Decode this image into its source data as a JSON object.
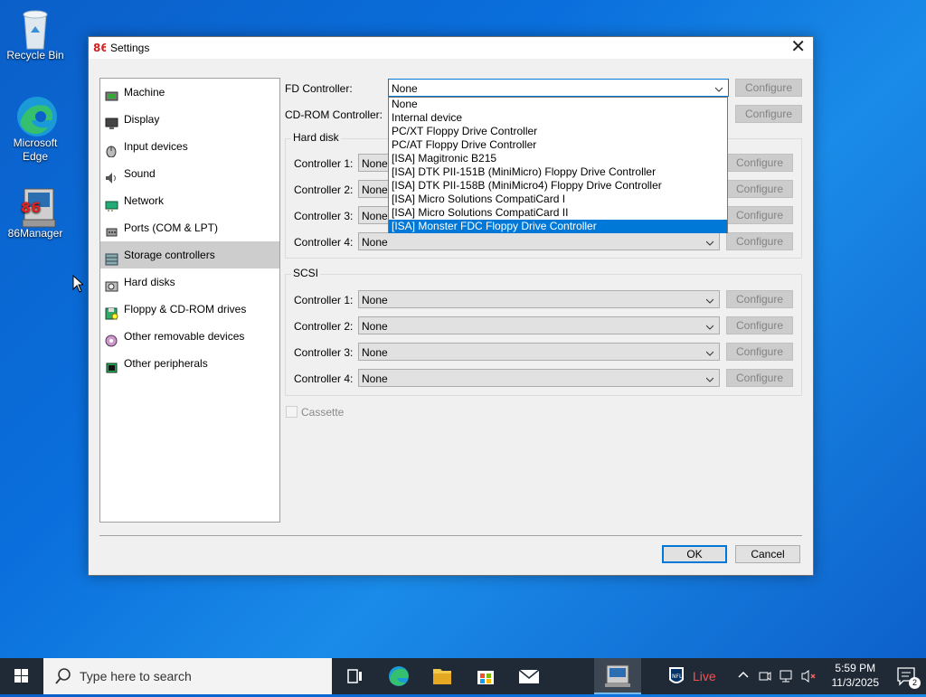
{
  "desktop": {
    "icons": [
      {
        "label": "Recycle Bin"
      },
      {
        "label": "Microsoft Edge"
      },
      {
        "label": "86Manager"
      }
    ]
  },
  "dialog": {
    "title": "Settings",
    "sidebar": [
      {
        "label": "Machine",
        "icon": "machine-icon"
      },
      {
        "label": "Display",
        "icon": "display-icon"
      },
      {
        "label": "Input devices",
        "icon": "input-devices-icon"
      },
      {
        "label": "Sound",
        "icon": "sound-icon"
      },
      {
        "label": "Network",
        "icon": "network-icon"
      },
      {
        "label": "Ports (COM & LPT)",
        "icon": "ports-icon"
      },
      {
        "label": "Storage controllers",
        "icon": "storage-icon",
        "selected": true
      },
      {
        "label": "Hard disks",
        "icon": "hard-disk-icon"
      },
      {
        "label": "Floppy & CD-ROM drives",
        "icon": "floppy-icon"
      },
      {
        "label": "Other removable devices",
        "icon": "removable-icon"
      },
      {
        "label": "Other peripherals",
        "icon": "peripherals-icon"
      }
    ],
    "fd_controller": {
      "label": "FD Controller:",
      "value": "None",
      "configure": "Configure"
    },
    "cdrom_controller": {
      "label": "CD-ROM Controller:",
      "configure": "Configure"
    },
    "fd_dropdown": {
      "options": [
        "None",
        "Internal device",
        "PC/XT Floppy Drive Controller",
        "PC/AT Floppy Drive Controller",
        "[ISA] Magitronic B215",
        "[ISA] DTK PII-151B (MiniMicro) Floppy Drive Controller",
        "[ISA] DTK PII-158B (MiniMicro4) Floppy Drive Controller",
        "[ISA] Micro Solutions CompatiCard I",
        "[ISA] Micro Solutions CompatiCard II",
        "[ISA] Monster FDC Floppy Drive Controller"
      ],
      "highlighted": "[ISA] Monster FDC Floppy Drive Controller"
    },
    "hard_disk": {
      "title": "Hard disk",
      "controllers": [
        {
          "label": "Controller 1:",
          "value": "None",
          "configure": "Configure"
        },
        {
          "label": "Controller 2:",
          "value": "None",
          "configure": "Configure"
        },
        {
          "label": "Controller 3:",
          "value": "None",
          "configure": "Configure"
        },
        {
          "label": "Controller 4:",
          "value": "None",
          "configure": "Configure"
        }
      ]
    },
    "scsi": {
      "title": "SCSI",
      "controllers": [
        {
          "label": "Controller 1:",
          "value": "None",
          "configure": "Configure"
        },
        {
          "label": "Controller 2:",
          "value": "None",
          "configure": "Configure"
        },
        {
          "label": "Controller 3:",
          "value": "None",
          "configure": "Configure"
        },
        {
          "label": "Controller 4:",
          "value": "None",
          "configure": "Configure"
        }
      ]
    },
    "cassette": {
      "label": "Cassette",
      "checked": false
    },
    "ok": "OK",
    "cancel": "Cancel"
  },
  "taskbar": {
    "search_placeholder": "Type here to search",
    "news_badge": "Live",
    "time": "5:59 PM",
    "date": "11/3/2025",
    "notification_count": "2"
  },
  "colors": {
    "accent": "#0078d7",
    "taskbar": "#1f2a36",
    "desktop": "#0a6fdc"
  }
}
